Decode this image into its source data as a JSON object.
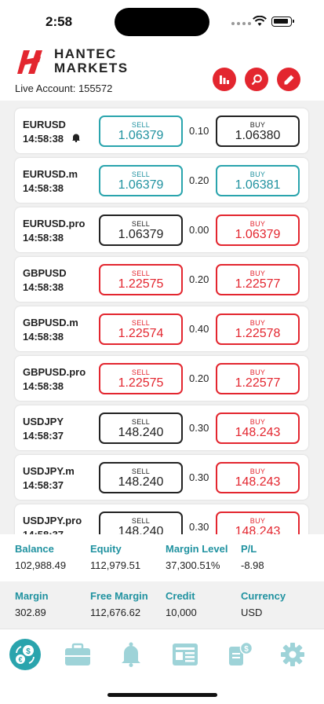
{
  "status": {
    "time": "2:58"
  },
  "brand": {
    "line1": "HANTEC",
    "line2": "MARKETS"
  },
  "account": "Live Account: 155572",
  "toolbar": {
    "icons": [
      "bar-chart-icon",
      "search-icon",
      "edit-icon"
    ]
  },
  "colors": {
    "red": "#e3262f",
    "teal": "#2092a0"
  },
  "quotes": [
    {
      "symbol": "EURUSD",
      "time": "14:58:38",
      "alert": true,
      "sell_label": "SELL",
      "sell": "1.06379",
      "sell_color": "teal",
      "spread": "0.10",
      "buy_label": "BUY",
      "buy": "1.06380",
      "buy_color": "dark"
    },
    {
      "symbol": "EURUSD.m",
      "time": "14:58:38",
      "alert": false,
      "sell_label": "SELL",
      "sell": "1.06379",
      "sell_color": "teal",
      "spread": "0.20",
      "buy_label": "BUY",
      "buy": "1.06381",
      "buy_color": "teal"
    },
    {
      "symbol": "EURUSD.pro",
      "time": "14:58:38",
      "alert": false,
      "sell_label": "SELL",
      "sell": "1.06379",
      "sell_color": "dark",
      "spread": "0.00",
      "buy_label": "BUY",
      "buy": "1.06379",
      "buy_color": "red"
    },
    {
      "symbol": "GBPUSD",
      "time": "14:58:38",
      "alert": false,
      "sell_label": "SELL",
      "sell": "1.22575",
      "sell_color": "red",
      "spread": "0.20",
      "buy_label": "BUY",
      "buy": "1.22577",
      "buy_color": "red"
    },
    {
      "symbol": "GBPUSD.m",
      "time": "14:58:38",
      "alert": false,
      "sell_label": "SELL",
      "sell": "1.22574",
      "sell_color": "red",
      "spread": "0.40",
      "buy_label": "BUY",
      "buy": "1.22578",
      "buy_color": "red"
    },
    {
      "symbol": "GBPUSD.pro",
      "time": "14:58:38",
      "alert": false,
      "sell_label": "SELL",
      "sell": "1.22575",
      "sell_color": "red",
      "spread": "0.20",
      "buy_label": "BUY",
      "buy": "1.22577",
      "buy_color": "red"
    },
    {
      "symbol": "USDJPY",
      "time": "14:58:37",
      "alert": false,
      "sell_label": "SELL",
      "sell": "148.240",
      "sell_color": "dark",
      "spread": "0.30",
      "buy_label": "BUY",
      "buy": "148.243",
      "buy_color": "red"
    },
    {
      "symbol": "USDJPY.m",
      "time": "14:58:37",
      "alert": false,
      "sell_label": "SELL",
      "sell": "148.240",
      "sell_color": "dark",
      "spread": "0.30",
      "buy_label": "BUY",
      "buy": "148.243",
      "buy_color": "red"
    },
    {
      "symbol": "USDJPY.pro",
      "time": "14:58:37",
      "alert": false,
      "sell_label": "SELL",
      "sell": "148.240",
      "sell_color": "dark",
      "spread": "0.30",
      "buy_label": "BUY",
      "buy": "148.243",
      "buy_color": "red"
    }
  ],
  "summary": {
    "balance_label": "Balance",
    "balance": "102,988.49",
    "equity_label": "Equity",
    "equity": "112,979.51",
    "margin_level_label": "Margin Level",
    "margin_level": "37,300.51%",
    "pl_label": "P/L",
    "pl": "-8.98",
    "margin_label": "Margin",
    "margin": "302.89",
    "free_margin_label": "Free Margin",
    "free_margin": "112,676.62",
    "credit_label": "Credit",
    "credit": "10,000",
    "currency_label": "Currency",
    "currency": "USD"
  },
  "tabs": [
    "quotes-icon",
    "portfolio-icon",
    "alerts-icon",
    "news-icon",
    "transfer-icon",
    "settings-icon"
  ]
}
